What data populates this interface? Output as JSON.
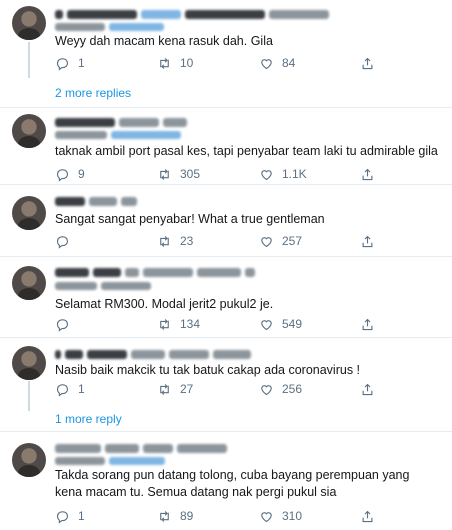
{
  "tweets": [
    {
      "text": "Weyy dah macam kena rasuk dah. Gila",
      "replies": "1",
      "retweets": "10",
      "likes": "84"
    },
    {
      "text": "taknak ambil port pasal kes, tapi penyabar team laki tu admirable gila",
      "replies": "9",
      "retweets": "305",
      "likes": "1.1K"
    },
    {
      "text": "Sangat sangat penyabar! What a true gentleman",
      "replies": "",
      "retweets": "23",
      "likes": "257"
    },
    {
      "text": "Selamat RM300. Modal jerit2 pukul2 je.",
      "replies": "",
      "retweets": "134",
      "likes": "549"
    },
    {
      "text": "Nasib baik makcik tu tak batuk cakap ada coronavirus !",
      "replies": "1",
      "retweets": "27",
      "likes": "256"
    },
    {
      "text": "Takda sorang pun datang tolong, cuba bayang perempuan yang kena macam tu. Semua datang nak pergi pukul sia",
      "replies": "1",
      "retweets": "89",
      "likes": "310"
    }
  ],
  "more_replies": [
    {
      "label": "2 more replies"
    },
    {
      "label": "1 more reply"
    }
  ],
  "icons": {
    "reply": "speech-bubble-icon",
    "retweet": "retweet-arrows-icon",
    "like": "heart-icon",
    "share": "share-upload-icon"
  },
  "colors": {
    "text": "#14171a",
    "muted": "#5b7083",
    "link": "#1b95e0",
    "divider": "#e6ecf0"
  }
}
